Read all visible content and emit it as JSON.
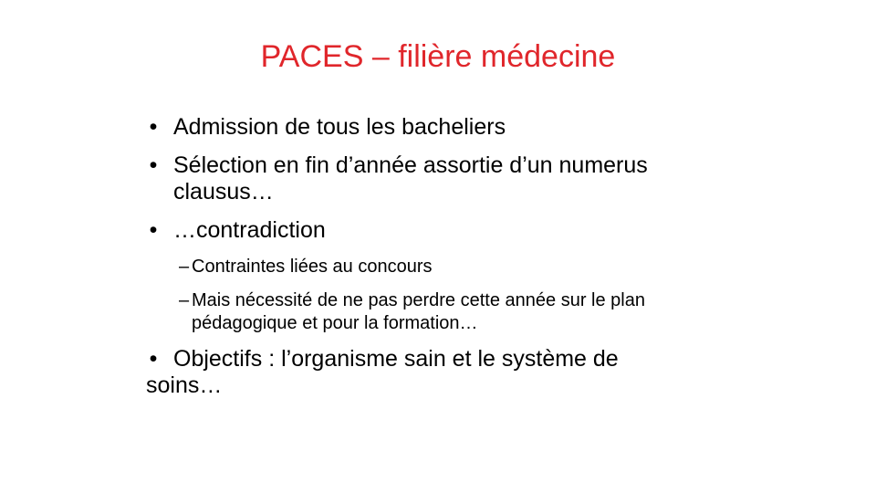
{
  "slide": {
    "title": "PACES – filière médecine",
    "bullets": [
      {
        "marker": "•",
        "text": "Admission de tous les bacheliers"
      },
      {
        "marker": "•",
        "text": "Sélection en fin d’année assortie d’un numerus clausus…"
      },
      {
        "marker": "•",
        "text": "…contradiction"
      }
    ],
    "sub_bullets": [
      {
        "marker": "–",
        "text": "Contraintes liées au concours"
      },
      {
        "marker": "–",
        "text": "Mais nécessité de ne pas perdre cette année sur le plan pédagogique et pour la formation…"
      }
    ],
    "last_bullet": {
      "marker": "•",
      "line1": "Objectifs : l’organisme sain et le système de",
      "line2": "soins…"
    }
  },
  "colors": {
    "title": "#e0262b",
    "text": "#000000",
    "background": "#ffffff"
  }
}
